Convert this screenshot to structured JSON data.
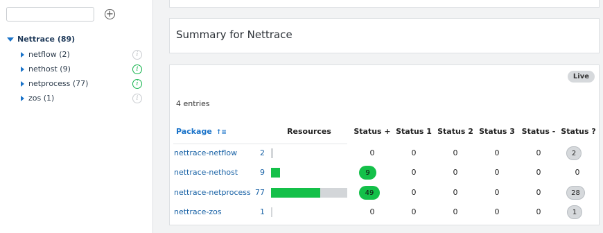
{
  "sidebar": {
    "search": {
      "value": "",
      "placeholder": ""
    },
    "add_icon": "plus-circle-icon",
    "root": {
      "label": "Nettrace (89)"
    },
    "items": [
      {
        "label": "netflow (2)",
        "info": "grey"
      },
      {
        "label": "nethost (9)",
        "info": "green"
      },
      {
        "label": "netprocess (77)",
        "info": "green"
      },
      {
        "label": "zos (1)",
        "info": "grey"
      }
    ]
  },
  "summary": {
    "title": "Summary for Nettrace"
  },
  "table": {
    "live_label": "Live",
    "entries_label": "4 entries",
    "headers": {
      "package": "Package",
      "resources": "Resources",
      "status_plus": "Status +",
      "status_1": "Status 1",
      "status_2": "Status 2",
      "status_3": "Status 3",
      "status_minus": "Status -",
      "status_q": "Status ?"
    },
    "rows": [
      {
        "package": "nettrace-netflow",
        "count": "2",
        "plus": "0",
        "s1": "0",
        "s2": "0",
        "s3": "0",
        "minus": "0",
        "q": "2"
      },
      {
        "package": "nettrace-nethost",
        "count": "9",
        "plus": "9",
        "s1": "0",
        "s2": "0",
        "s3": "0",
        "minus": "0",
        "q": "0"
      },
      {
        "package": "nettrace-netprocess",
        "count": "77",
        "plus": "49",
        "s1": "0",
        "s2": "0",
        "s3": "0",
        "minus": "0",
        "q": "28"
      },
      {
        "package": "nettrace-zos",
        "count": "1",
        "plus": "0",
        "s1": "0",
        "s2": "0",
        "s3": "0",
        "minus": "0",
        "q": "1"
      }
    ],
    "colors": {
      "ok": "#14c049",
      "unknown": "#d3d6d9",
      "link": "#1a63a6"
    }
  }
}
